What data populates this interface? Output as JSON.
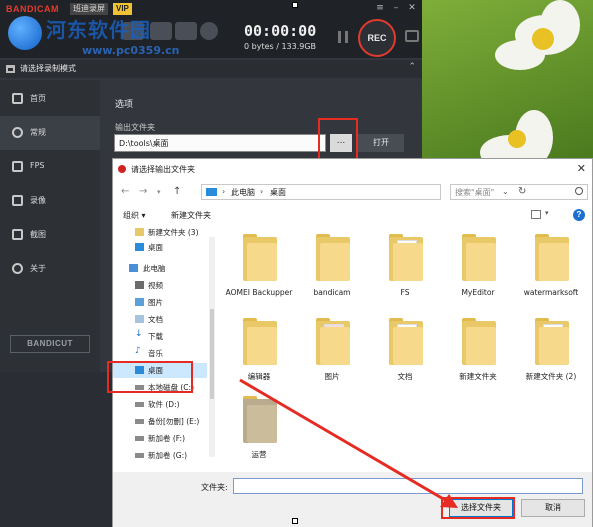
{
  "bandicam": {
    "logo": "BANDICAM",
    "product": "班迪录屏",
    "vip": "VIP",
    "timer": "00:00:00",
    "size": "0 bytes / 133.9GB",
    "rec_label": "REC",
    "mode_bar_text": "请选择录制模式",
    "sidebar": {
      "items": [
        {
          "label": "首页"
        },
        {
          "label": "常规"
        },
        {
          "label": "FPS"
        },
        {
          "label": "录像"
        },
        {
          "label": "截图"
        },
        {
          "label": "关于"
        }
      ]
    },
    "bandicut": "BANDICUT",
    "options_title": "选项",
    "output_folder_label": "输出文件夹",
    "output_folder_value": "D:\\tools\\桌面",
    "browse_label": "...",
    "open_label": "打开"
  },
  "watermark": {
    "title": "河东软件园",
    "url": "www.pc0359.cn"
  },
  "dialog": {
    "title": "请选择输出文件夹",
    "breadcrumb": [
      "此电脑",
      "桌面"
    ],
    "search_placeholder": "搜索\"桌面\"",
    "organize_label": "组织 ▾",
    "new_folder_label": "新建文件夹",
    "tree": [
      {
        "label": "新建文件夹 (3)",
        "icon": "folder-icon"
      },
      {
        "label": "桌面",
        "icon": "desktop-icon"
      },
      {
        "label": "此电脑",
        "icon": "computer-icon"
      },
      {
        "label": "视频",
        "icon": "video-icon"
      },
      {
        "label": "图片",
        "icon": "picture-icon"
      },
      {
        "label": "文档",
        "icon": "document-icon"
      },
      {
        "label": "下载",
        "icon": "download-icon"
      },
      {
        "label": "音乐",
        "icon": "music-icon"
      },
      {
        "label": "桌面",
        "icon": "desktop-icon"
      },
      {
        "label": "本地磁盘 (C:)",
        "icon": "drive-icon"
      },
      {
        "label": "软件 (D:)",
        "icon": "drive-icon"
      },
      {
        "label": "备份[勿删] (E:)",
        "icon": "drive-icon"
      },
      {
        "label": "新加卷 (F:)",
        "icon": "drive-icon"
      },
      {
        "label": "新加卷 (G:)",
        "icon": "drive-icon"
      }
    ],
    "files": [
      {
        "label": "AOMEI Backupper"
      },
      {
        "label": "bandicam"
      },
      {
        "label": "FS"
      },
      {
        "label": "MyEditor"
      },
      {
        "label": "watermarksoft"
      },
      {
        "label": "编辑器"
      },
      {
        "label": "图片"
      },
      {
        "label": "文档"
      },
      {
        "label": "新建文件夹"
      },
      {
        "label": "新建文件夹 (2)"
      },
      {
        "label": "运营"
      }
    ],
    "filename_label": "文件夹:",
    "filename_value": "",
    "select_label": "选择文件夹",
    "cancel_label": "取消"
  },
  "colors": {
    "highlight": "#e52b22",
    "rec_ring": "#e03b2e",
    "folder": "#f6d98a",
    "selection": "#cce8ff",
    "accent": "#0078d7"
  }
}
